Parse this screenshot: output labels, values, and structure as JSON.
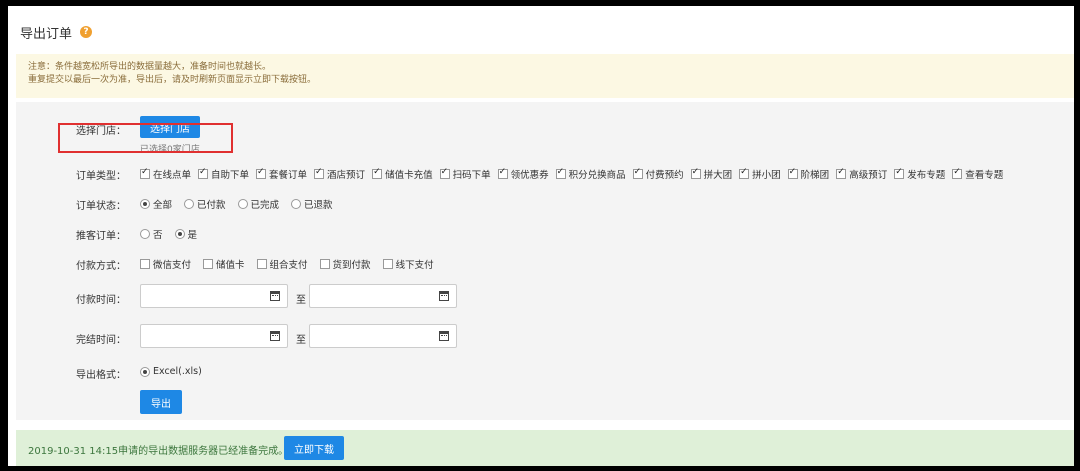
{
  "header": {
    "title": "导出订单",
    "help_glyph": "?"
  },
  "notice": {
    "line1": "注意：条件越宽松所导出的数据量越大，准备时间也就越长。",
    "line2": "重复提交以最后一次为准，导出后，请及时刷新页面显示立即下载按钮。"
  },
  "store": {
    "label": "选择门店：",
    "button": "选择门店",
    "hint": "已选择0家门店"
  },
  "order_type": {
    "label": "订单类型：",
    "options": [
      "在线点单",
      "自助下单",
      "套餐订单",
      "酒店预订",
      "储值卡充值",
      "扫码下单",
      "领优惠券",
      "积分兑换商品",
      "付费预约",
      "拼大团",
      "拼小团",
      "阶梯团",
      "高级预订",
      "发布专题",
      "查看专题"
    ]
  },
  "order_status": {
    "label": "订单状态：",
    "options": [
      "全部",
      "已付款",
      "已完成",
      "已退款"
    ],
    "selected": "全部"
  },
  "tuike": {
    "label": "推客订单：",
    "options": [
      "否",
      "是"
    ],
    "selected": "是"
  },
  "payment": {
    "label": "付款方式：",
    "options": [
      "微信支付",
      "储值卡",
      "组合支付",
      "货到付款",
      "线下支付"
    ]
  },
  "pay_time": {
    "label": "付款时间：",
    "from": "",
    "to": "",
    "sep": "至"
  },
  "finish_time": {
    "label": "完结时间：",
    "from": "",
    "to": "",
    "sep": "至"
  },
  "format": {
    "label": "导出格式：",
    "option": "Excel(.xls)"
  },
  "export_button": "导出",
  "footer": {
    "text": "2019-10-31 14:15申请的导出数据服务器已经准备完成。",
    "download_button": "立即下载"
  },
  "colors": {
    "accent": "#1e88e5",
    "notice_bg": "#fcf8e3",
    "footer_bg": "#dff0d8",
    "highlight": "#e03030"
  }
}
